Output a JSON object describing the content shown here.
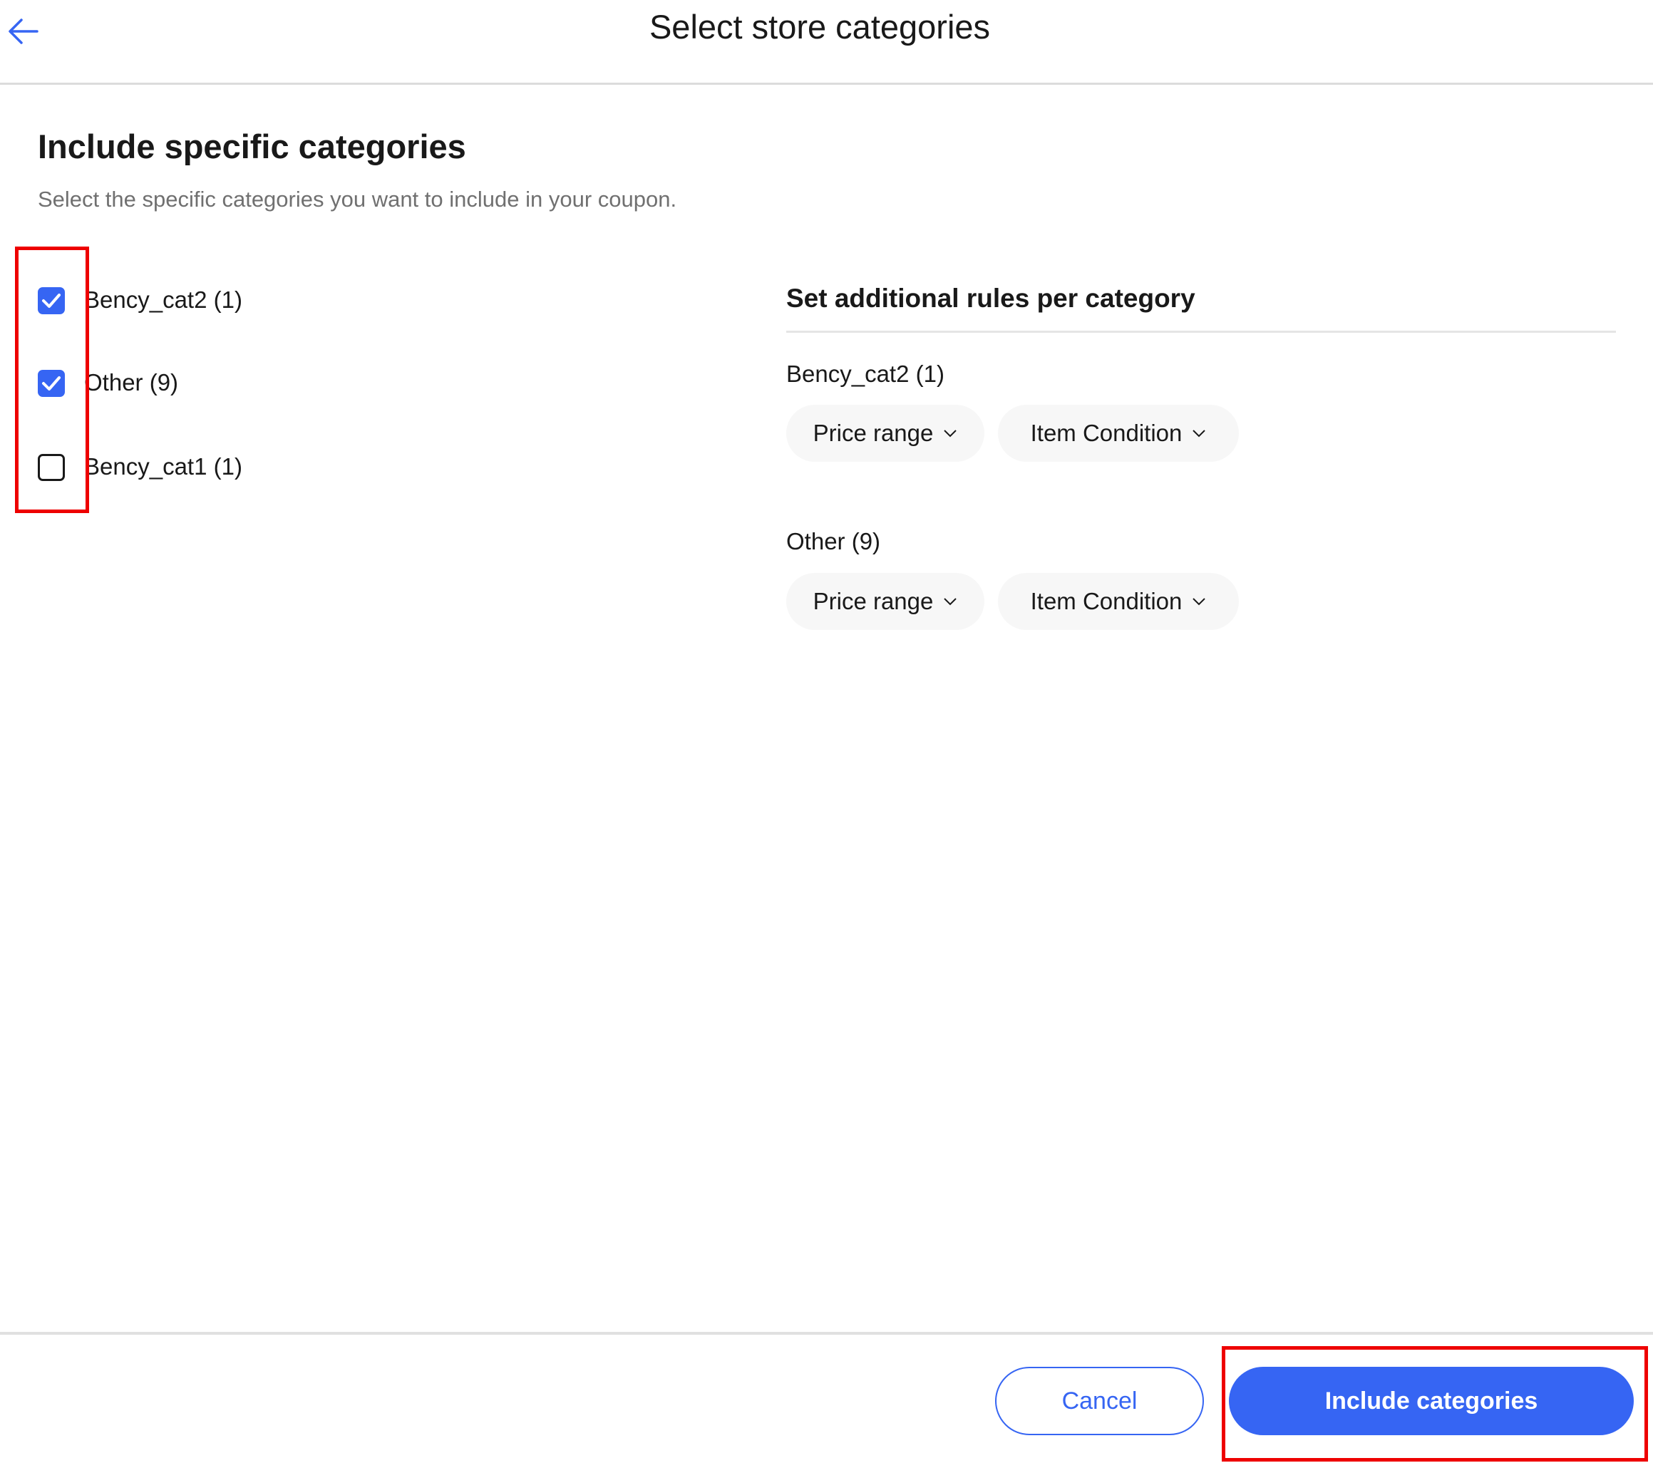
{
  "header": {
    "back_icon": "arrow-left-icon",
    "title": "Select store categories"
  },
  "section": {
    "heading": "Include specific categories",
    "subtitle": "Select the specific categories you want to include in your coupon."
  },
  "categories": [
    {
      "label": "Bency_cat2 (1)",
      "checked": true
    },
    {
      "label": "Other (9)",
      "checked": true
    },
    {
      "label": "Bency_cat1 (1)",
      "checked": false
    }
  ],
  "rules": {
    "heading": "Set additional rules per category",
    "groups": [
      {
        "label": "Bency_cat2 (1)",
        "price_label": "Price range",
        "condition_label": "Item Condition"
      },
      {
        "label": "Other (9)",
        "price_label": "Price range",
        "condition_label": "Item Condition"
      }
    ]
  },
  "footer": {
    "cancel_label": "Cancel",
    "include_label": "Include categories"
  },
  "colors": {
    "accent": "#3665f3",
    "annotation": "#ee0000"
  }
}
